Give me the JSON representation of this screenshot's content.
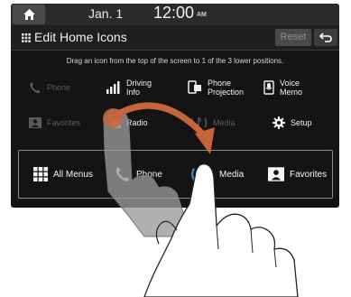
{
  "status_bar": {
    "date": "Jan. 1",
    "time": "12:00",
    "ampm": "AM"
  },
  "header": {
    "title": "Edit Home Icons",
    "reset_label": "Reset"
  },
  "instruction": "Drag an icon from the top of the screen to 1 of the 3 lower positions.",
  "top_icons": [
    {
      "label": "Phone",
      "icon": "phone-icon",
      "enabled": false
    },
    {
      "label": "Driving Info",
      "icon": "bar-chart-icon",
      "enabled": true
    },
    {
      "label": "Phone Projection",
      "icon": "phone-projection-icon",
      "enabled": true
    },
    {
      "label": "Voice Memo",
      "icon": "voice-memo-icon",
      "enabled": true
    },
    {
      "label": "Favorites",
      "icon": "favorites-icon",
      "enabled": false
    },
    {
      "label": "Radio",
      "icon": "radio-icon",
      "enabled": true
    },
    {
      "label": "Media",
      "icon": "media-icon",
      "enabled": false
    },
    {
      "label": "Setup",
      "icon": "gear-icon",
      "enabled": true
    }
  ],
  "bottom_icons": [
    {
      "label": "All Menus",
      "icon": "all-menus-icon"
    },
    {
      "label": "Phone",
      "icon": "phone-icon"
    },
    {
      "label": "Media",
      "icon": "media-icon"
    },
    {
      "label": "Favorites",
      "icon": "favorites-icon"
    }
  ],
  "colors": {
    "screen_bg": "#141414",
    "text": "#f0f0f0",
    "dim_text": "#5b5b5b",
    "arrow": "#c8643c"
  }
}
